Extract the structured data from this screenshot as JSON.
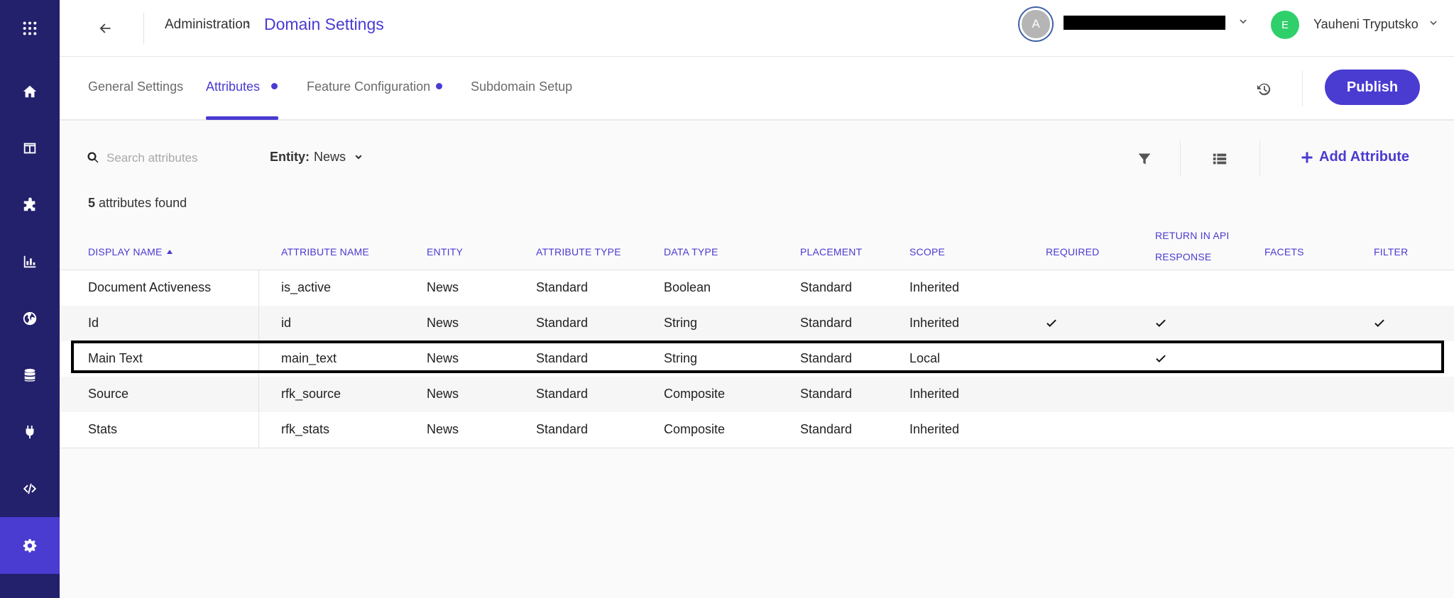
{
  "header": {
    "breadcrumb_parent": "Administration",
    "breadcrumb_sep": "›",
    "breadcrumb_current": "Domain Settings",
    "account_initial": "A",
    "user_initial": "E",
    "user_name": "Yauheni Tryputsko"
  },
  "tabs": [
    {
      "label": "General Settings",
      "active": false,
      "dot": false
    },
    {
      "label": "Attributes",
      "active": true,
      "dot": true
    },
    {
      "label": "Feature Configuration",
      "active": false,
      "dot": true
    },
    {
      "label": "Subdomain Setup",
      "active": false,
      "dot": false
    }
  ],
  "actions": {
    "publish_label": "Publish",
    "add_attribute_label": "Add Attribute"
  },
  "search": {
    "placeholder": "Search attributes",
    "value": ""
  },
  "entity_filter": {
    "label": "Entity:",
    "value": "News"
  },
  "results": {
    "count": "5",
    "suffix": "attributes found"
  },
  "table": {
    "columns": [
      {
        "label": "Display Name",
        "sorted": "asc"
      },
      {
        "label": "Attribute Name"
      },
      {
        "label": "Entity"
      },
      {
        "label": "Attribute Type"
      },
      {
        "label": "Data Type"
      },
      {
        "label": "Placement"
      },
      {
        "label": "Scope"
      },
      {
        "label": "Required"
      },
      {
        "label": "Return In API Response"
      },
      {
        "label": "Facets"
      },
      {
        "label": "Filter"
      }
    ],
    "rows": [
      {
        "display_name": "Document Activeness",
        "attribute_name": "is_active",
        "entity": "News",
        "attribute_type": "Standard",
        "data_type": "Boolean",
        "placement": "Standard",
        "scope": "Inherited",
        "required": false,
        "return_in_api": false,
        "facets": false,
        "filter": false
      },
      {
        "display_name": "Id",
        "attribute_name": "id",
        "entity": "News",
        "attribute_type": "Standard",
        "data_type": "String",
        "placement": "Standard",
        "scope": "Inherited",
        "required": true,
        "return_in_api": true,
        "facets": false,
        "filter": true
      },
      {
        "display_name": "Main Text",
        "attribute_name": "main_text",
        "entity": "News",
        "attribute_type": "Standard",
        "data_type": "String",
        "placement": "Standard",
        "scope": "Local",
        "required": false,
        "return_in_api": true,
        "facets": false,
        "filter": false,
        "highlighted": true
      },
      {
        "display_name": "Source",
        "attribute_name": "rfk_source",
        "entity": "News",
        "attribute_type": "Standard",
        "data_type": "Composite",
        "placement": "Standard",
        "scope": "Inherited",
        "required": false,
        "return_in_api": false,
        "facets": false,
        "filter": false
      },
      {
        "display_name": "Stats",
        "attribute_name": "rfk_stats",
        "entity": "News",
        "attribute_type": "Standard",
        "data_type": "Composite",
        "placement": "Standard",
        "scope": "Inherited",
        "required": false,
        "return_in_api": false,
        "facets": false,
        "filter": false
      }
    ]
  },
  "sidebar": {
    "items": [
      {
        "icon": "apps-grid-icon"
      },
      {
        "icon": "home-icon"
      },
      {
        "icon": "layout-icon"
      },
      {
        "icon": "puzzle-icon"
      },
      {
        "icon": "bar-chart-icon"
      },
      {
        "icon": "globe-icon"
      },
      {
        "icon": "database-icon"
      },
      {
        "icon": "plug-icon"
      },
      {
        "icon": "code-icon"
      },
      {
        "icon": "gear-icon",
        "active": true
      }
    ]
  },
  "colors": {
    "accent": "#4a3bd1",
    "sidebar": "#23206c",
    "user_avatar": "#2fcf6b"
  }
}
